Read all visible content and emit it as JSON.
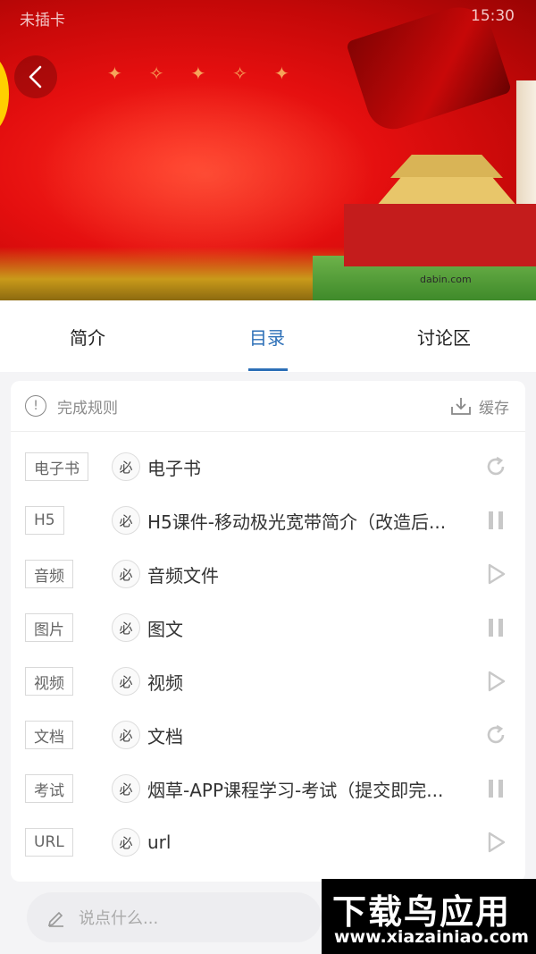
{
  "status_bar": {
    "carrier": "未插卡",
    "time": "15:30"
  },
  "hero": {
    "watermark": "dabin.com"
  },
  "tabs": [
    {
      "label": "简介"
    },
    {
      "label": "目录"
    },
    {
      "label": "讨论区"
    }
  ],
  "toolbar": {
    "rules_label": "完成规则",
    "cache_label": "缓存"
  },
  "required_label": "必",
  "items": [
    {
      "type": "电子书",
      "title": "电子书",
      "action": "refresh-icon"
    },
    {
      "type": "H5",
      "title": "H5课件-移动极光宽带简介（改造后...",
      "action": "pause-icon"
    },
    {
      "type": "音频",
      "title": "音频文件",
      "action": "play-icon"
    },
    {
      "type": "图片",
      "title": "图文",
      "action": "pause-icon"
    },
    {
      "type": "视频",
      "title": "视频",
      "action": "play-icon"
    },
    {
      "type": "文档",
      "title": "文档",
      "action": "refresh-icon"
    },
    {
      "type": "考试",
      "title": "烟草-APP课程学习-考试（提交即完...",
      "action": "pause-icon"
    },
    {
      "type": "URL",
      "title": "url",
      "action": "play-icon"
    }
  ],
  "comment": {
    "placeholder": "说点什么..."
  },
  "watermark": {
    "brand": "下载鸟应用",
    "url": "www.xiazainiao.com"
  },
  "colors": {
    "accent": "#2c6fb7",
    "hero_red": "#e40f0f"
  }
}
